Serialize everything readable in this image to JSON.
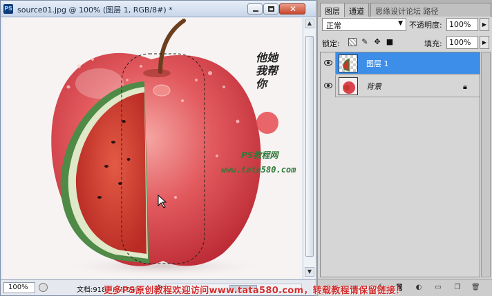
{
  "document": {
    "title": "source01.jpg @ 100% (图层 1, RGB/8#) *",
    "app_icon": "PS",
    "zoom": "100%",
    "info": "文档:918.8K/1.59M",
    "artwork": {
      "signature_lines": [
        "他她",
        "我帮",
        "你"
      ],
      "site_name": "PS教程网",
      "site_url": "www.tata580.com"
    }
  },
  "panel": {
    "tabs": [
      {
        "label": "图层",
        "active": true
      },
      {
        "label": "通道",
        "active": false
      },
      {
        "label": "思缘设计论坛 路径",
        "active": false
      }
    ],
    "blend_mode": "正常",
    "opacity_label": "不透明度:",
    "opacity_value": "100%",
    "lock_label": "锁定:",
    "fill_label": "填充:",
    "fill_value": "100%",
    "layers": [
      {
        "name": "图层 1",
        "selected": true,
        "visible": true,
        "locked": false
      },
      {
        "name": "背景",
        "selected": false,
        "visible": true,
        "locked": true
      }
    ]
  },
  "watermark": "更多PS原创教程欢迎访问www.tata580.com，转载教程请保留链接！",
  "colors": {
    "selection_blue": "#3d8ee8",
    "apple_red": "#d9434f",
    "melon_red": "#c8362b",
    "rind_green": "#3f7a3a"
  }
}
